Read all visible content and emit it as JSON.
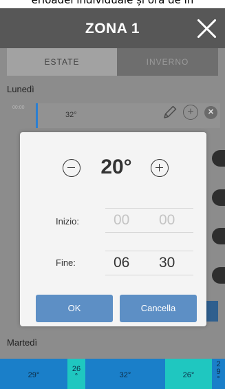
{
  "caption": "erioadei individuale și ora de in",
  "header": {
    "title": "ZONA 1"
  },
  "tabs": {
    "summer": "ESTATE",
    "winter": "INVERNO"
  },
  "day": {
    "monday": "Lunedì",
    "tuesday": "Martedì"
  },
  "schedule": {
    "time_label": "00:00",
    "row_value": "32°"
  },
  "tuesday_bar": [
    "29°",
    "26\n°",
    "32°",
    "26°",
    "2\n9\n°"
  ],
  "colors": {
    "accent": "#2b7fd1",
    "button": "#5d8fc5",
    "header": "#575757"
  },
  "modal": {
    "temperature": "20°",
    "start_label": "Inizio:",
    "start_hour": "00",
    "start_minute": "00",
    "end_label": "Fine:",
    "end_hour": "06",
    "end_minute": "30",
    "ok_label": "OK",
    "cancel_label": "Cancella"
  }
}
